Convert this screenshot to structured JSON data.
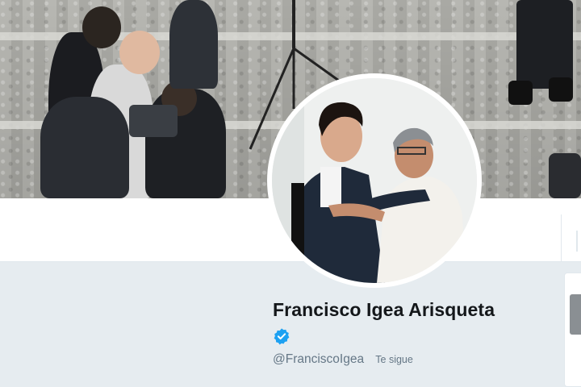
{
  "profile": {
    "name": "Francisco Igea Arisqueta",
    "handle": "@FranciscoIgea",
    "follows_you": "Te sigue",
    "verified": true
  },
  "colors": {
    "background": "#e6ecf0",
    "verified_badge": "#1da1f2",
    "name_text": "#14171a",
    "secondary_text": "#657786"
  },
  "icons": {
    "verified": "verified-badge-icon"
  }
}
